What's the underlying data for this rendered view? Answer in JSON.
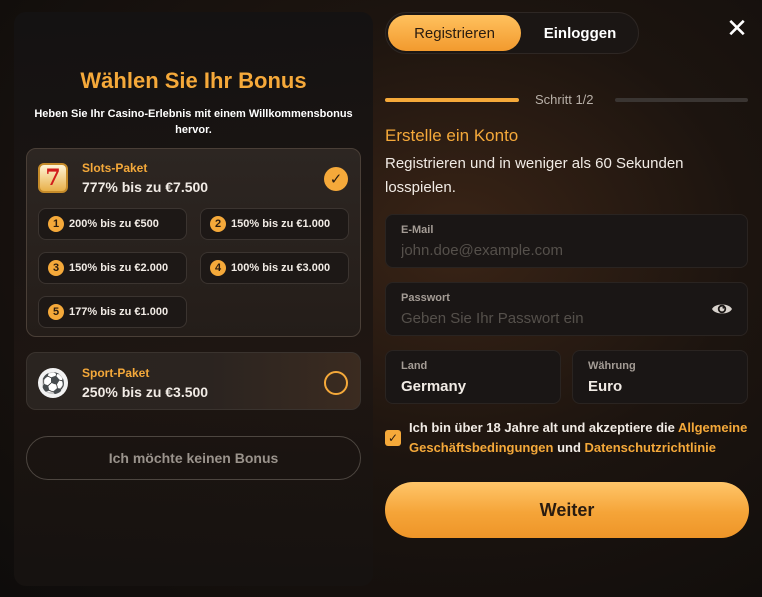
{
  "colors": {
    "accent": "#f5a93a",
    "panel": "#1a1615",
    "text": "#f1ebe5",
    "muted": "#a49c95"
  },
  "bonus": {
    "title": "Wählen Sie Ihr Bonus",
    "subtitle": "Heben Sie Ihr Casino-Erlebnis mit einem Willkommensbonus hervor.",
    "packages": [
      {
        "name": "Slots-Paket",
        "value": "777% bis zu €7.500",
        "icon": "slot-seven-icon",
        "icon_glyph": "7",
        "selected": true,
        "tiers": [
          {
            "num": "1",
            "text": "200% bis zu €500"
          },
          {
            "num": "2",
            "text": "150% bis zu €1.000"
          },
          {
            "num": "3",
            "text": "150% bis zu €2.000"
          },
          {
            "num": "4",
            "text": "100% bis zu €3.000"
          },
          {
            "num": "5",
            "text": "177% bis zu €1.000"
          }
        ]
      },
      {
        "name": "Sport-Paket",
        "value": "250% bis zu €3.500",
        "icon": "soccer-ball-icon",
        "icon_glyph": "⚽",
        "selected": false
      }
    ],
    "no_bonus_label": "Ich möchte keinen Bonus"
  },
  "tabs": {
    "register": "Registrieren",
    "login": "Einloggen"
  },
  "close_glyph": "✕",
  "step": {
    "label": "Schritt 1/2",
    "current": 1,
    "total": 2
  },
  "form": {
    "title": "Erstelle ein Konto",
    "subtitle": "Registrieren und in weniger als 60 Sekunden losspielen.",
    "email": {
      "label": "E-Mail",
      "placeholder": "john.doe@example.com",
      "value": ""
    },
    "password": {
      "label": "Passwort",
      "placeholder": "Geben Sie Ihr Passwort ein",
      "value": ""
    },
    "country": {
      "label": "Land",
      "value": "Germany"
    },
    "currency": {
      "label": "Währung",
      "value": "Euro"
    },
    "terms": {
      "checked": true,
      "check_glyph": "✓",
      "prefix": "Ich bin über 18 Jahre alt und akzeptiere die ",
      "link1": "Allgemeine Geschäftsbedingungen",
      "middle": " und ",
      "link2": "Datenschutzrichtlinie"
    },
    "submit_label": "Weiter"
  }
}
